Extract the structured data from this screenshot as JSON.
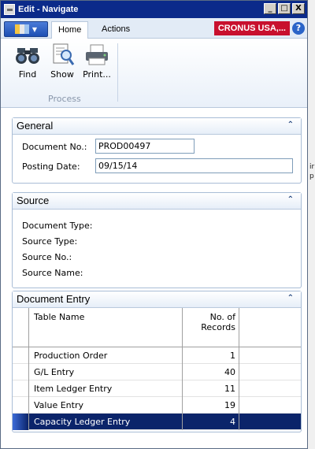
{
  "window": {
    "title": "Edit - Navigate"
  },
  "window_buttons": {
    "minimize": "_",
    "maximize": "□",
    "close": "X"
  },
  "ribbon": {
    "tabs": [
      {
        "label": "Home"
      },
      {
        "label": "Actions"
      }
    ],
    "company": "CRONUS USA,...",
    "help": "?",
    "buttons": [
      {
        "label": "Find"
      },
      {
        "label": "Show"
      },
      {
        "label": "Print..."
      }
    ],
    "group_label": "Process"
  },
  "general": {
    "title": "General",
    "document_no_label": "Document No.:",
    "document_no_value": "PROD00497",
    "posting_date_label": "Posting Date:",
    "posting_date_value": "09/15/14"
  },
  "source": {
    "title": "Source",
    "labels": [
      "Document Type:",
      "Source Type:",
      "Source No.:",
      "Source Name:"
    ]
  },
  "document_entry": {
    "title": "Document Entry",
    "columns": {
      "table_name": "Table Name",
      "records_line1": "No. of",
      "records_line2": "Records"
    },
    "rows": [
      {
        "table": "Production Order",
        "records": "1"
      },
      {
        "table": "G/L Entry",
        "records": "40"
      },
      {
        "table": "Item Ledger Entry",
        "records": "11"
      },
      {
        "table": "Value Entry",
        "records": "19"
      },
      {
        "table": "Capacity Ledger Entry",
        "records": "4"
      }
    ],
    "selected_row": 4
  },
  "colors": {
    "title_bar": "#0b2a8a",
    "company_badge": "#c8102e",
    "selection": "#0b246a"
  }
}
